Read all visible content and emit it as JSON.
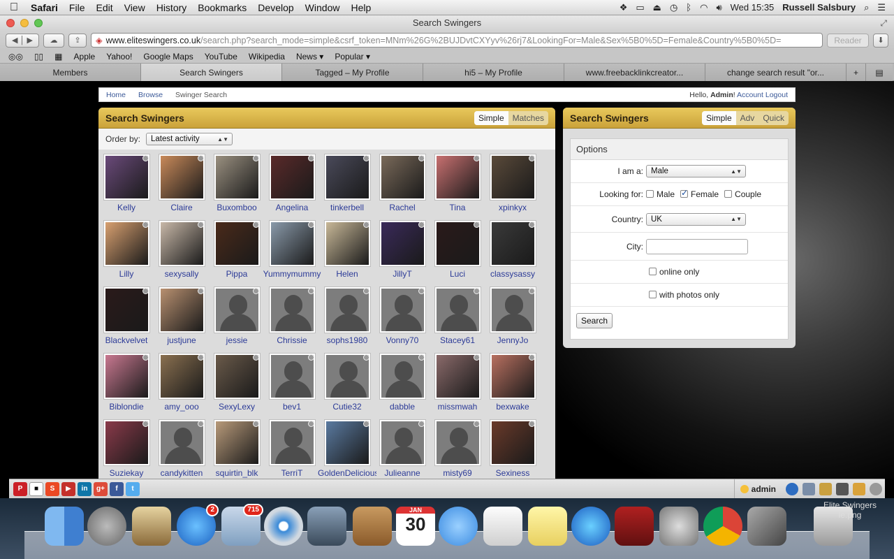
{
  "menubar": {
    "app_name": "Safari",
    "items": [
      "File",
      "Edit",
      "View",
      "History",
      "Bookmarks",
      "Develop",
      "Window",
      "Help"
    ],
    "clock": "Wed 15:35",
    "user": "Russell Salsbury"
  },
  "window": {
    "title": "Search Swingers"
  },
  "toolbar": {
    "url_host": "www.eliteswingers.co.uk",
    "url_rest": "/search.php?search_mode=simple&csrf_token=MNm%26G%2BUJDvtCXYyv%26rj7&LookingFor=Male&Sex%5B0%5D=Female&Country%5B0%5D=",
    "reader_label": "Reader"
  },
  "bookmarks": [
    "Apple",
    "Yahoo!",
    "Google Maps",
    "YouTube",
    "Wikipedia",
    "News ▾",
    "Popular ▾"
  ],
  "tabs": [
    {
      "label": "Members"
    },
    {
      "label": "Search Swingers"
    },
    {
      "label": "Tagged – My Profile"
    },
    {
      "label": "hi5 – My Profile"
    },
    {
      "label": "www.freebacklinkcreator..."
    },
    {
      "label": "change search result \"or..."
    }
  ],
  "breadcrumb": {
    "items": [
      "Home",
      "Browse",
      "Swinger Search"
    ],
    "hello_prefix": "Hello,",
    "hello_user": "Admin",
    "hello_suffix": "!",
    "account": "Account",
    "logout": "Logout"
  },
  "left_panel": {
    "title": "Search Swingers",
    "tab_simple": "Simple",
    "tab_matches": "Matches",
    "order_label": "Order by:",
    "order_value": "Latest activity"
  },
  "members": [
    {
      "name": "Kelly",
      "photo": true,
      "color": "#6a4a7a"
    },
    {
      "name": "Claire",
      "photo": true,
      "color": "#c98a5a"
    },
    {
      "name": "Buxomboo",
      "photo": true,
      "color": "#9a9080"
    },
    {
      "name": "Angelina",
      "photo": true,
      "color": "#5a2a2a"
    },
    {
      "name": "tinkerbell",
      "photo": true,
      "color": "#4a4a5a"
    },
    {
      "name": "Rachel",
      "photo": true,
      "color": "#7a6a5a"
    },
    {
      "name": "Tina",
      "photo": true,
      "color": "#c87070"
    },
    {
      "name": "xpinkyx",
      "photo": true,
      "color": "#5a4a3a"
    },
    {
      "name": "Lilly",
      "photo": true,
      "color": "#d8a070"
    },
    {
      "name": "sexysally",
      "photo": true,
      "color": "#c8b8a8"
    },
    {
      "name": "Pippa",
      "photo": true,
      "color": "#4a2a1a"
    },
    {
      "name": "Yummymummy",
      "photo": true,
      "color": "#8a9aaa"
    },
    {
      "name": "Helen",
      "photo": true,
      "color": "#c8b898"
    },
    {
      "name": "JillyT",
      "photo": true,
      "color": "#3a2a5a"
    },
    {
      "name": "Luci",
      "photo": true,
      "color": "#2a1a1a"
    },
    {
      "name": "classysassy",
      "photo": true,
      "color": "#3a3a3a"
    },
    {
      "name": "Blackvelvet",
      "photo": true,
      "color": "#2a1a1a"
    },
    {
      "name": "justjune",
      "photo": true,
      "color": "#b89070"
    },
    {
      "name": "jessie",
      "photo": false
    },
    {
      "name": "Chrissie",
      "photo": false
    },
    {
      "name": "sophs1980",
      "photo": false
    },
    {
      "name": "Vonny70",
      "photo": false
    },
    {
      "name": "Stacey61",
      "photo": false
    },
    {
      "name": "JennyJo",
      "photo": false
    },
    {
      "name": "Biblondie",
      "photo": true,
      "color": "#c87890"
    },
    {
      "name": "amy_ooo",
      "photo": true,
      "color": "#8a7050"
    },
    {
      "name": "SexyLexy",
      "photo": true,
      "color": "#6a5a4a"
    },
    {
      "name": "bev1",
      "photo": false
    },
    {
      "name": "Cutie32",
      "photo": false
    },
    {
      "name": "dabble",
      "photo": false
    },
    {
      "name": "missmwah",
      "photo": true,
      "color": "#8a6a6a"
    },
    {
      "name": "bexwake",
      "photo": true,
      "color": "#b87060"
    },
    {
      "name": "Suziekay",
      "photo": true,
      "color": "#8a3a4a"
    },
    {
      "name": "candykitten",
      "photo": false
    },
    {
      "name": "squirtin_blk",
      "photo": true,
      "color": "#b89a7a"
    },
    {
      "name": "TerriT",
      "photo": false
    },
    {
      "name": "GoldenDelicious",
      "photo": true,
      "color": "#5a7aa0"
    },
    {
      "name": "Julieanne",
      "photo": false
    },
    {
      "name": "misty69",
      "photo": false
    },
    {
      "name": "Sexiness",
      "photo": true,
      "color": "#6a3a2a"
    }
  ],
  "right_panel": {
    "title": "Search Swingers",
    "tab_simple": "Simple",
    "tab_adv": "Adv",
    "tab_quick": "Quick",
    "options_label": "Options",
    "iam_label": "I am a:",
    "iam_value": "Male",
    "looking_label": "Looking for:",
    "looking_male": "Male",
    "looking_female": "Female",
    "looking_couple": "Couple",
    "country_label": "Country:",
    "country_value": "UK",
    "city_label": "City:",
    "city_value": "",
    "online_only": "online only",
    "with_photos": "with photos only",
    "search_button": "Search"
  },
  "bottombar": {
    "user": "admin"
  },
  "dock": {
    "appstore_badge": "2",
    "mail_badge": "715",
    "calendar_month": "JAN",
    "calendar_day": "30"
  },
  "desktop": {
    "file_line1": "Elite Swingers",
    "file_line2": "le.png"
  }
}
